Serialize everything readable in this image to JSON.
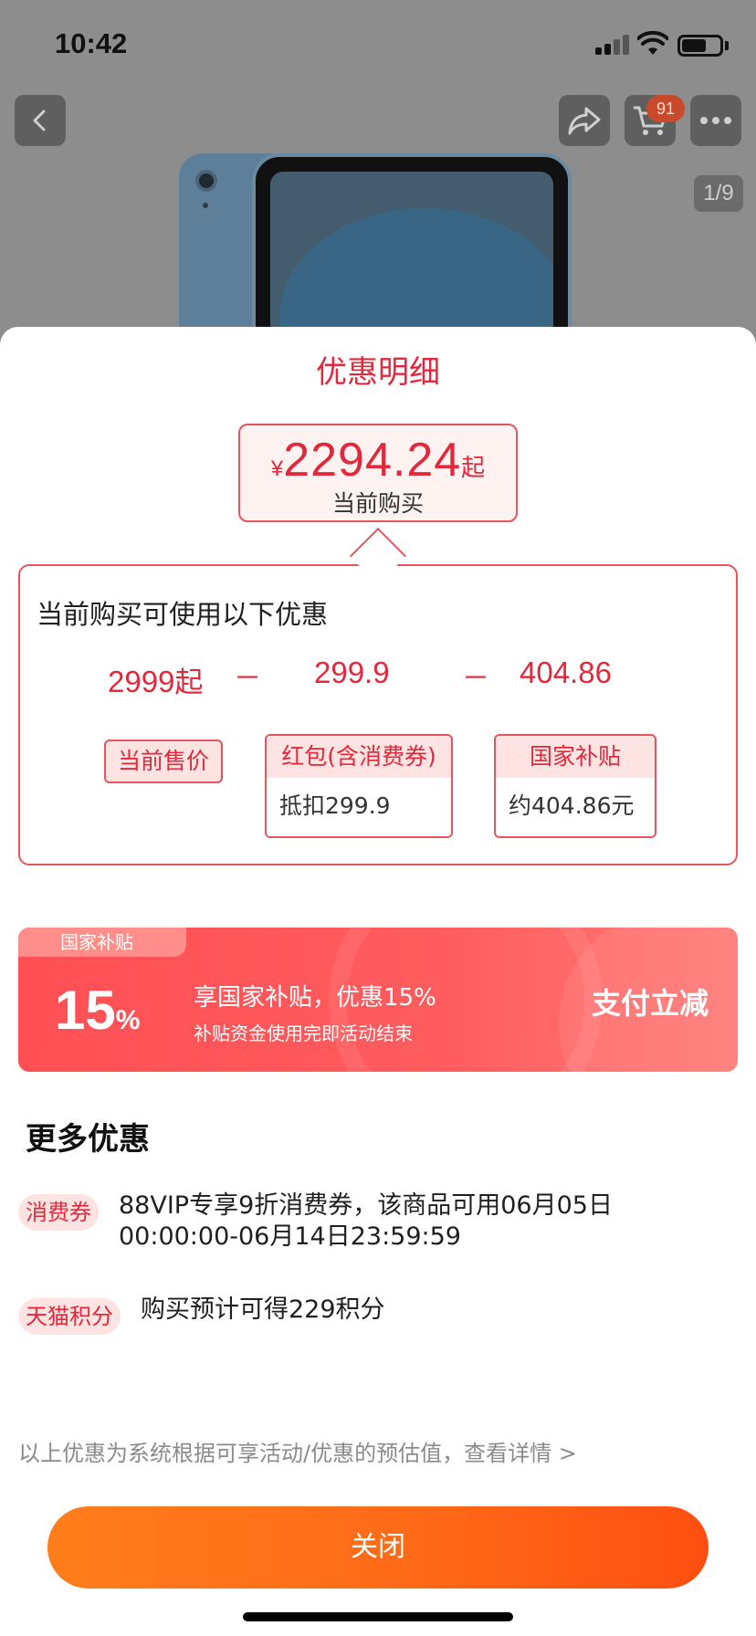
{
  "status_bar": {
    "time": "10:42"
  },
  "background_page": {
    "cart_badge": "91",
    "image_counter": "1/9"
  },
  "sheet": {
    "title": "优惠明细",
    "price": {
      "currency": "¥",
      "amount": "2294.24",
      "suffix": "起",
      "label": "当前购买"
    },
    "formula": {
      "heading": "当前购买可使用以下优惠",
      "base_value": "2999",
      "base_suffix": "起",
      "minus": "－",
      "discount1_value": "299.9",
      "discount2_value": "404.86",
      "base_label": "当前售价",
      "discount1_label": "红包(含消费券)",
      "discount1_detail": "抵扣299.9",
      "discount2_label": "国家补贴",
      "discount2_detail": "约404.86元"
    },
    "banner": {
      "tag": "国家补贴",
      "percent": "15",
      "percent_sign": "%",
      "title": "享国家补贴，优惠15%",
      "subtitle": "补贴资金使用完即活动结束",
      "cta": "支付立减"
    },
    "more": {
      "title": "更多优惠",
      "offers": [
        {
          "tag": "消费券",
          "text": "88VIP专享9折消费券，该商品可用06月05日00:00:00-06月14日23:59:59"
        },
        {
          "tag": "天猫积分",
          "text": "购买预计可得229积分"
        }
      ]
    },
    "disclaimer": "以上优惠为系统根据可享活动/优惠的预估值，查看详情 >",
    "close_button": "关闭"
  },
  "colors": {
    "accent_red": "#e3283b",
    "tag_bg": "#fde4e3",
    "banner_red": "#ff4f55",
    "close_orange": "#ff6a17"
  }
}
